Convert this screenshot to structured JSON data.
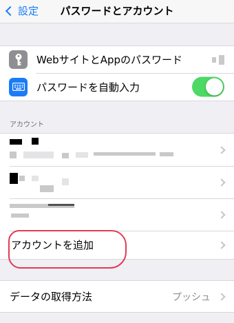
{
  "navbar": {
    "back_label": "設定",
    "title": "パスワードとアカウント"
  },
  "passwords_group": {
    "websites_label": "WebサイトとAppのパスワード",
    "autofill_label": "パスワードを自動入力",
    "autofill_enabled": true
  },
  "accounts_section": {
    "header": "アカウント",
    "add_account_label": "アカウントを追加"
  },
  "fetch_group": {
    "label": "データの取得方法",
    "value": "プッシュ"
  },
  "colors": {
    "accent": "#1a7cf6",
    "toggle_on": "#4cd964",
    "annotation": "#e23a55"
  }
}
